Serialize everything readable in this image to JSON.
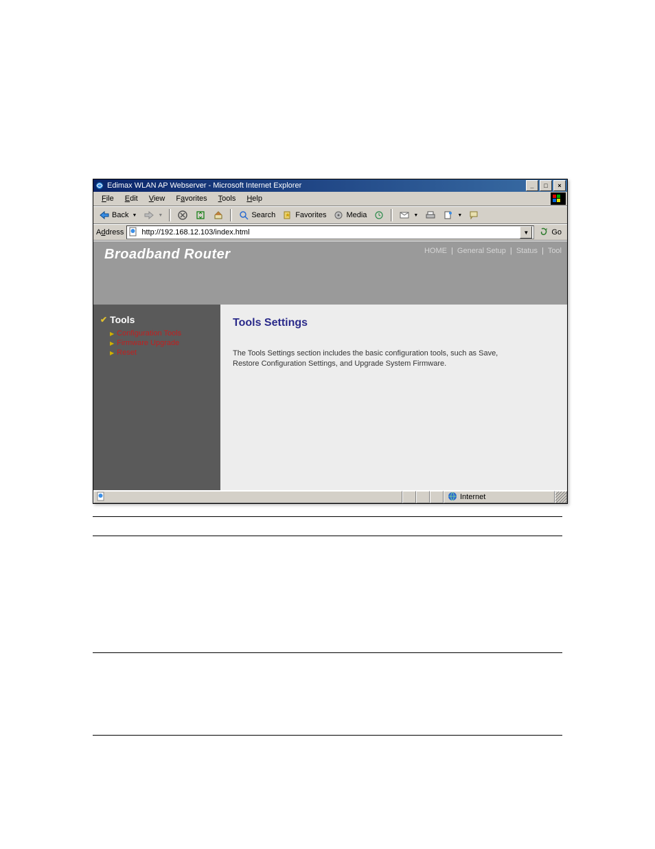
{
  "window": {
    "title": "Edimax WLAN AP Webserver - Microsoft Internet Explorer"
  },
  "menu": {
    "file": "File",
    "edit": "Edit",
    "view": "View",
    "favorites": "Favorites",
    "tools": "Tools",
    "help": "Help"
  },
  "toolbar": {
    "back": "Back",
    "search": "Search",
    "favorites": "Favorites",
    "media": "Media"
  },
  "address": {
    "label": "Address",
    "url": "http://192.168.12.103/index.html",
    "go": "Go"
  },
  "header": {
    "brand": "Broadband Router",
    "nav": {
      "home": "HOME",
      "general": "General Setup",
      "status": "Status",
      "tool": "Tool"
    }
  },
  "sidebar": {
    "title": "Tools",
    "items": [
      {
        "label": "Configuration Tools"
      },
      {
        "label": "Firmware Upgrade"
      },
      {
        "label": "Reset"
      }
    ]
  },
  "main": {
    "heading": "Tools Settings",
    "body": "The Tools Settings section includes the basic configuration tools, such as Save, Restore Configuration Settings, and Upgrade System Firmware."
  },
  "status": {
    "zone": "Internet"
  }
}
